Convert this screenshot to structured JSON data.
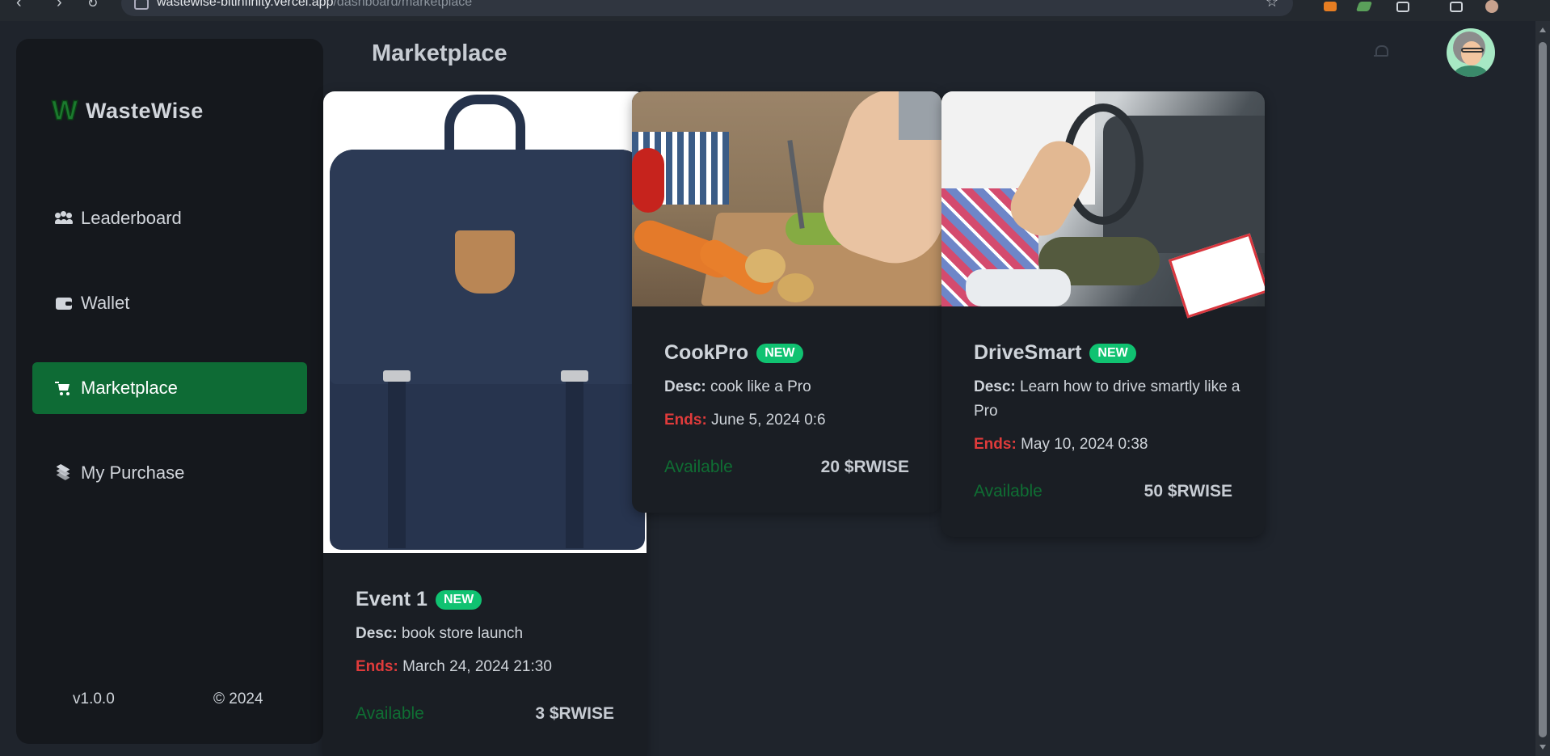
{
  "browser": {
    "url_host": "wastewise-bitinfinity.vercel.app",
    "url_path": "/dashboard/marketplace"
  },
  "sidebar": {
    "brand": "WasteWise",
    "items": [
      {
        "label": "Leaderboard",
        "icon": "users-icon"
      },
      {
        "label": "Wallet",
        "icon": "wallet-icon"
      },
      {
        "label": "Marketplace",
        "icon": "cart-icon",
        "active": true
      },
      {
        "label": "My Purchase",
        "icon": "layers-icon"
      }
    ],
    "version": "v1.0.0",
    "copyright": "© 2024"
  },
  "header": {
    "title": "Marketplace"
  },
  "theme": {
    "active_nav": "#0e6b35",
    "badge": "#10c271",
    "ends_label": "#e03b3b",
    "available": "#0f6e33"
  },
  "cards": [
    {
      "title": "Event 1",
      "badge": "NEW",
      "desc_label": "Desc:",
      "desc": "book store launch",
      "ends_label": "Ends:",
      "ends": "March 24, 2024 21:30",
      "status": "Available",
      "price": "3 $RWISE",
      "image": "backpack"
    },
    {
      "title": "CookPro",
      "badge": "NEW",
      "desc_label": "Desc:",
      "desc": "cook like a Pro",
      "ends_label": "Ends:",
      "ends": "June 5, 2024 0:6",
      "status": "Available",
      "price": "20 $RWISE",
      "image": "cooking"
    },
    {
      "title": "DriveSmart",
      "badge": "NEW",
      "desc_label": "Desc:",
      "desc": "Learn how to drive smartly like a Pro",
      "ends_label": "Ends:",
      "ends": "May 10, 2024 0:38",
      "status": "Available",
      "price": "50 $RWISE",
      "image": "driving"
    }
  ]
}
